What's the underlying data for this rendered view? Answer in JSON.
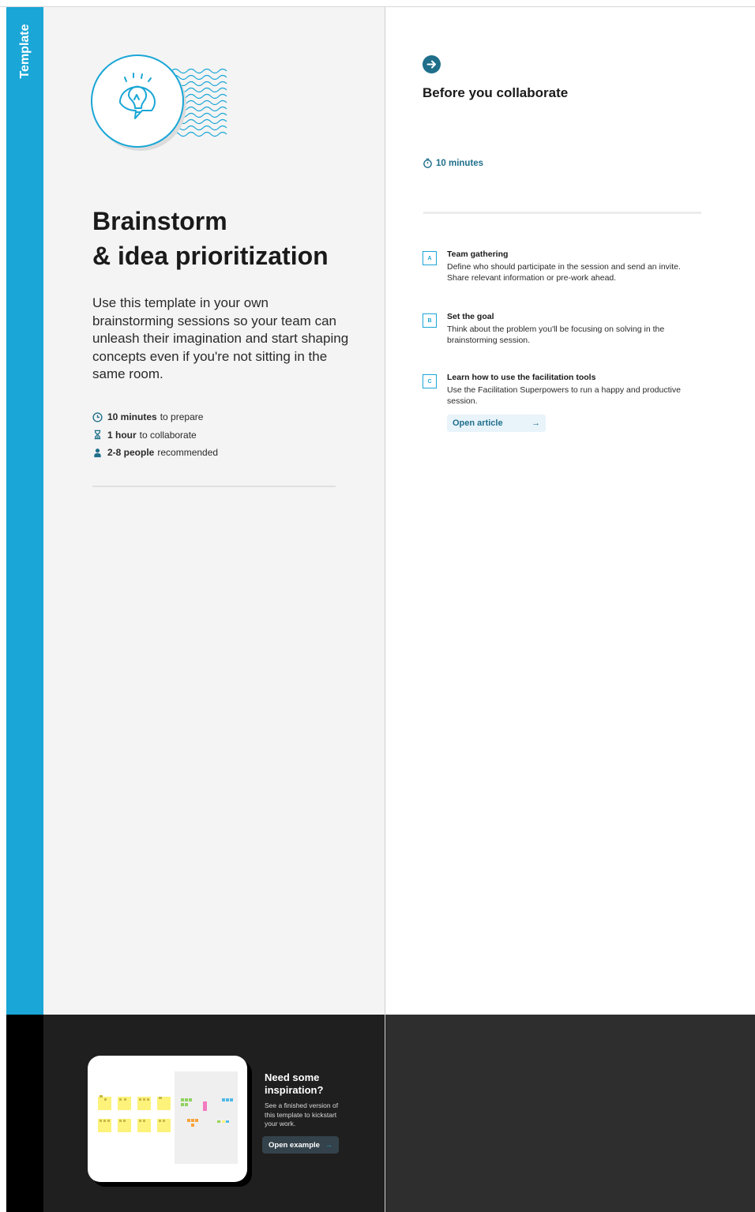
{
  "sidebar": {
    "label": "Template"
  },
  "hero": {
    "title_line1": "Brainstorm",
    "title_line2": "& idea prioritization",
    "description": "Use this template in your own brainstorming sessions so your team can unleash their imagination and start shaping concepts even if you're not sitting in the same room."
  },
  "meta": [
    {
      "icon": "clock-icon",
      "bold": "10 minutes",
      "text": "to prepare"
    },
    {
      "icon": "hourglass-icon",
      "bold": "1 hour",
      "text": "to collaborate"
    },
    {
      "icon": "person-icon",
      "bold": "2-8 people",
      "text": "recommended"
    }
  ],
  "step": {
    "title": "Before you collaborate",
    "duration": "10 minutes"
  },
  "tasks": [
    {
      "letter": "A",
      "title": "Team gathering",
      "description": "Define who should participate in the session and send an invite. Share relevant information or pre-work ahead."
    },
    {
      "letter": "B",
      "title": "Set the goal",
      "description": "Think about the problem you'll be focusing on solving in the brainstorming session."
    },
    {
      "letter": "C",
      "title": "Learn how to use the facilitation tools",
      "description": "Use the Facilitation Superpowers to run a happy and productive session."
    }
  ],
  "open_article": {
    "label": "Open article",
    "arrow": "→"
  },
  "inspiration": {
    "title": "Need some inspiration?",
    "description": "See a finished version of this template to kickstart your work.",
    "button_label": "Open example",
    "arrow": "→"
  },
  "colors": {
    "accent": "#1aa6d6",
    "teal_dark": "#1f6f8b",
    "sticky_yellow": "#fdf27a"
  }
}
